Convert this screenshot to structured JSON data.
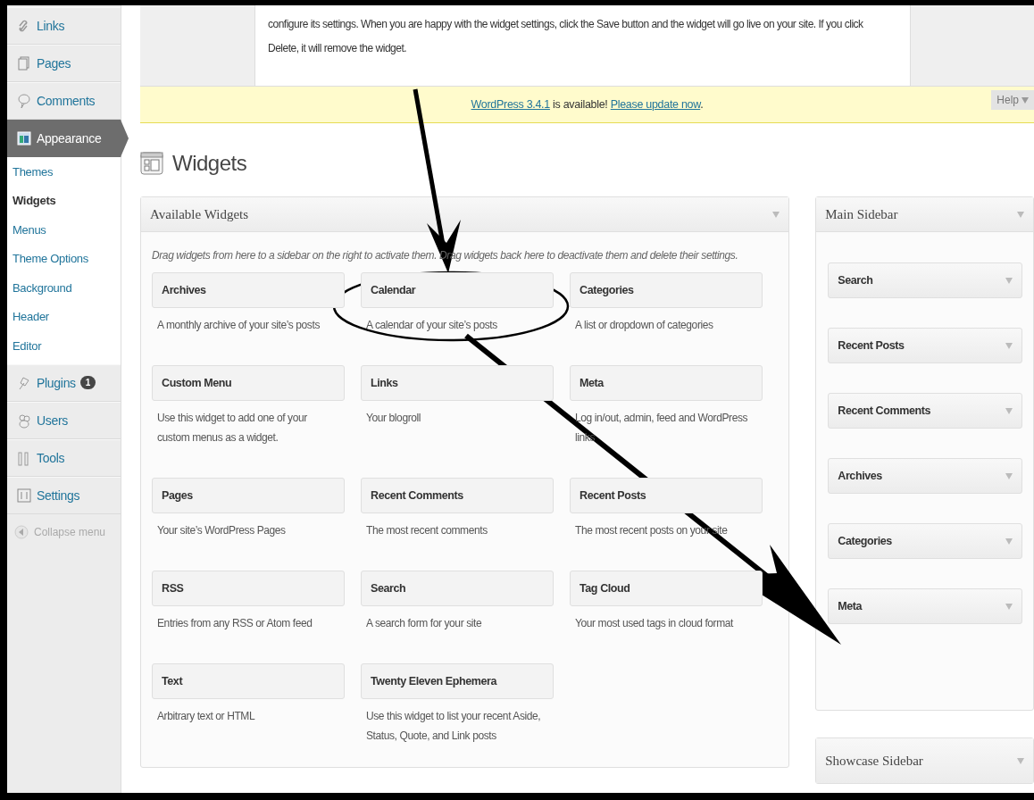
{
  "sidebar": {
    "items": [
      {
        "label": "Links",
        "selected": false
      },
      {
        "label": "Pages",
        "selected": false
      },
      {
        "label": "Comments",
        "selected": false
      },
      {
        "label": "Appearance",
        "selected": true,
        "children": [
          {
            "label": "Themes",
            "selected": false
          },
          {
            "label": "Widgets",
            "selected": true
          },
          {
            "label": "Menus",
            "selected": false
          },
          {
            "label": "Theme Options",
            "selected": false
          },
          {
            "label": "Background",
            "selected": false
          },
          {
            "label": "Header",
            "selected": false
          },
          {
            "label": "Editor",
            "selected": false
          }
        ]
      },
      {
        "label": "Plugins",
        "selected": false,
        "badge": "1"
      },
      {
        "label": "Users",
        "selected": false
      },
      {
        "label": "Tools",
        "selected": false
      },
      {
        "label": "Settings",
        "selected": false
      }
    ],
    "collapse": "Collapse menu"
  },
  "help": {
    "lines": [
      "configure its settings. When you are happy with the widget settings, click the Save button and the widget will go live on your site. If you click",
      "Delete, it will remove the widget."
    ]
  },
  "notice": {
    "link": "WordPress 3.4.1",
    "text": " is available! ",
    "action": "Please update now",
    "end": "."
  },
  "help_tab": "Help",
  "page_title": "Widgets",
  "available": {
    "title": "Available Widgets",
    "hint": "Drag widgets from here to a sidebar on the right to activate them. Drag widgets back here to deactivate them and delete their settings.",
    "widgets": [
      {
        "name": "Archives",
        "description": "A monthly archive of your site’s posts"
      },
      {
        "name": "Calendar",
        "description": "A calendar of your site’s posts"
      },
      {
        "name": "Categories",
        "description": "A list or dropdown of categories"
      },
      {
        "name": "Custom Menu",
        "description": "Use this widget to add one of your custom menus as a widget."
      },
      {
        "name": "Links",
        "description": "Your blogroll"
      },
      {
        "name": "Meta",
        "description": "Log in/out, admin, feed and WordPress links"
      },
      {
        "name": "Pages",
        "description": "Your site’s WordPress Pages"
      },
      {
        "name": "Recent Comments",
        "description": "The most recent comments"
      },
      {
        "name": "Recent Posts",
        "description": "The most recent posts on your site"
      },
      {
        "name": "RSS",
        "description": "Entries from any RSS or Atom feed"
      },
      {
        "name": "Search",
        "description": "A search form for your site"
      },
      {
        "name": "Tag Cloud",
        "description": "Your most used tags in cloud format"
      },
      {
        "name": "Text",
        "description": "Arbitrary text or HTML"
      },
      {
        "name": "Twenty Eleven Ephemera",
        "description": "Use this widget to list your recent Aside, Status, Quote, and Link posts"
      }
    ]
  },
  "sidebars": [
    {
      "title": "Main Sidebar",
      "expanded": true,
      "widgets": [
        "Search",
        "Recent Posts",
        "Recent Comments",
        "Archives",
        "Categories",
        "Meta"
      ]
    },
    {
      "title": "Showcase Sidebar",
      "expanded": false
    }
  ]
}
